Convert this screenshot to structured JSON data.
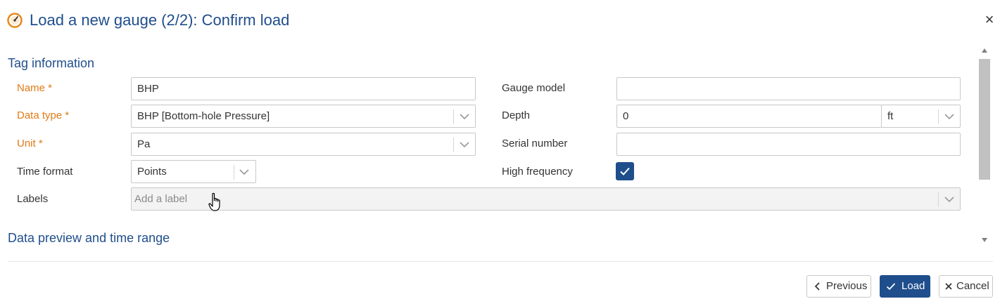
{
  "dialog": {
    "title": "Load a new gauge (2/2): Confirm load",
    "close_symbol": "×",
    "title_icon": "gauge-icon"
  },
  "tag_info": {
    "section_title": "Tag information",
    "name": {
      "label": "Name",
      "required_mark": " *",
      "value": "BHP"
    },
    "data_type": {
      "label": "Data type",
      "required_mark": " *",
      "value": "BHP [Bottom-hole Pressure]"
    },
    "unit": {
      "label": "Unit",
      "required_mark": " *",
      "value": "Pa"
    },
    "time_format": {
      "label": "Time format",
      "value": "Points"
    },
    "labels": {
      "label": "Labels",
      "placeholder": "Add a label"
    },
    "gauge_model": {
      "label": "Gauge model",
      "value": ""
    },
    "depth": {
      "label": "Depth",
      "value": "0",
      "unit": "ft"
    },
    "serial_number": {
      "label": "Serial number",
      "value": ""
    },
    "high_frequency": {
      "label": "High frequency",
      "checked": true
    }
  },
  "data_preview": {
    "section_title": "Data preview and time range"
  },
  "footer": {
    "previous_label": "Previous",
    "load_label": "Load",
    "cancel_label": "Cancel"
  },
  "colors": {
    "accent": "#1f4e8c",
    "required": "#e07b17",
    "icon_orange": "#e8891c"
  }
}
